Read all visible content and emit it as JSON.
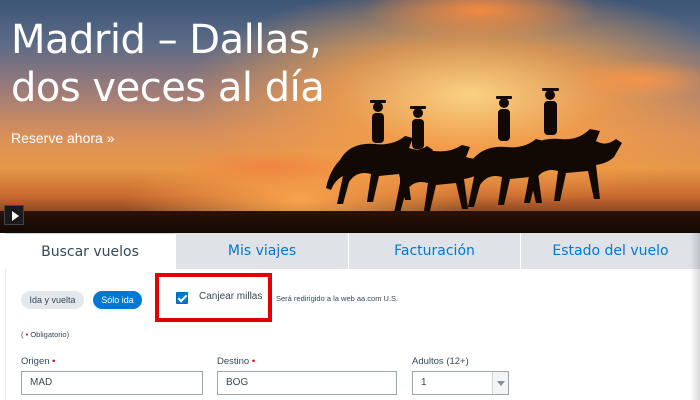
{
  "hero": {
    "title_line1": "Madrid – Dallas,",
    "title_line2": "dos veces al día",
    "cta": "Reserve ahora »"
  },
  "tabs": [
    {
      "label": "Buscar vuelos",
      "active": true
    },
    {
      "label": "Mis viajes",
      "active": false
    },
    {
      "label": "Facturación",
      "active": false
    },
    {
      "label": "Estado del vuelo",
      "active": false
    }
  ],
  "trip_type": {
    "round_trip": "Ida y vuelta",
    "one_way": "Sólo ida",
    "selected": "Sólo ida"
  },
  "redeem": {
    "label": "Canjear millas",
    "checked": true,
    "note": "Será redirigido a la web aa.com U.S."
  },
  "required": {
    "open": "( ",
    "star": "•",
    "text": " Obligatorio)"
  },
  "fields": {
    "origin": {
      "label": "Origen",
      "star": "•",
      "value": "MAD"
    },
    "destination": {
      "label": "Destino",
      "star": "•",
      "value": "BOG"
    },
    "adults": {
      "label": "Adultos (12+)",
      "value": "1"
    }
  },
  "colors": {
    "accent": "#0078d2",
    "highlight_box": "#e00000",
    "required_star": "#c30019"
  },
  "icons": {
    "play": "play-icon",
    "checkbox": "checkbox-checked-icon",
    "dropdown": "chevron-down-icon"
  }
}
